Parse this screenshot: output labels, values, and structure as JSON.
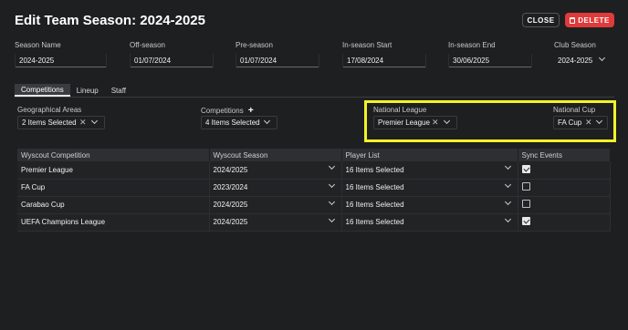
{
  "header": {
    "title": "Edit Team Season: 2024-2025",
    "close_label": "CLOSE",
    "delete_label": "DELETE"
  },
  "fields": [
    {
      "label": "Season Name",
      "value": "2024-2025"
    },
    {
      "label": "Off-season",
      "value": "01/07/2024"
    },
    {
      "label": "Pre-season",
      "value": "01/07/2024"
    },
    {
      "label": "In-season Start",
      "value": "17/08/2024"
    },
    {
      "label": "In-season End",
      "value": "30/06/2025"
    },
    {
      "label": "Club Season",
      "value": "2024-2025"
    }
  ],
  "tabs": [
    "Competitions",
    "Lineup",
    "Staff"
  ],
  "filters": {
    "geo": {
      "label": "Geographical Areas",
      "value": "2 Items Selected"
    },
    "competitions": {
      "label": "Competitions",
      "add": "+",
      "value": "4 Items Selected"
    },
    "national_league": {
      "label": "National League",
      "value": "Premier League"
    },
    "national_cup": {
      "label": "National Cup",
      "value": "FA Cup"
    }
  },
  "table": {
    "headers": [
      "Wyscout Competition",
      "Wyscout Season",
      "Player List",
      "Sync Events"
    ],
    "rows": [
      {
        "competition": "Premier League",
        "season": "2024/2025",
        "players": "16 Items Selected",
        "sync": true
      },
      {
        "competition": "FA Cup",
        "season": "2023/2024",
        "players": "16 Items Selected",
        "sync": false
      },
      {
        "competition": "Carabao Cup",
        "season": "2024/2025",
        "players": "16 Items Selected",
        "sync": false
      },
      {
        "competition": "UEFA Champions League",
        "season": "2024/2025",
        "players": "16 Items Selected",
        "sync": true
      }
    ]
  },
  "colors": {
    "background": "#1e1f21",
    "delete": "#e03a3a",
    "highlight": "#f2f22a"
  }
}
